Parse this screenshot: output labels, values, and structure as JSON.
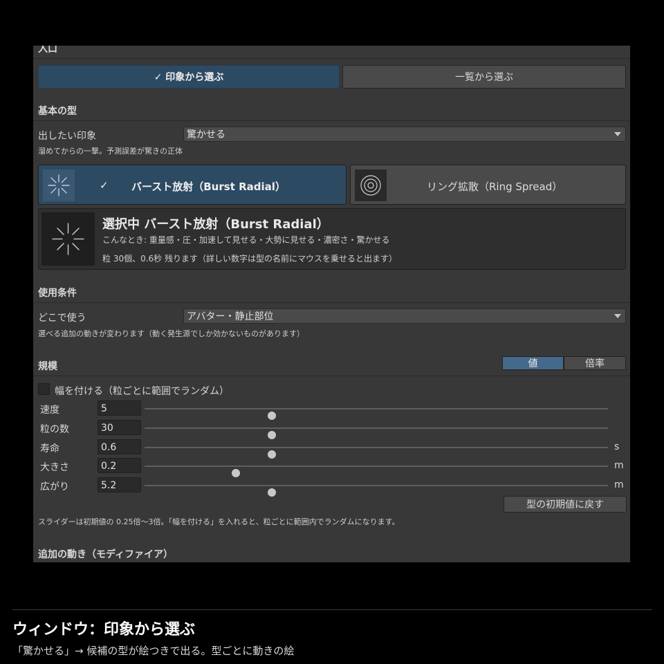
{
  "entry": {
    "header": "入口",
    "tab_selected": "✓ 印象から選ぶ",
    "tab_other": "一覧から選ぶ"
  },
  "basic_type": {
    "header": "基本の型",
    "impression_label": "出したい印象",
    "impression_value": "驚かせる",
    "impression_hint": "溜めてからの一撃。予測誤差が驚きの正体",
    "cards": [
      {
        "check": "✓",
        "label": "バースト放射（Burst Radial）",
        "icon": "burst-radial-icon",
        "selected": true
      },
      {
        "label": "リング拡散（Ring Spread）",
        "icon": "ring-spread-icon",
        "selected": false
      }
    ],
    "selected_info": {
      "title": "選択中 バースト放射（Burst Radial）",
      "usage": "こんなとき: 重量感・圧・加速して見せる・大勢に見せる・濃密さ・驚かせる",
      "detail": "粒 30個、0.6秒 残ります（詳しい数字は型の名前にマウスを乗せると出ます）",
      "icon": "burst-radial-icon"
    }
  },
  "usage_condition": {
    "header": "使用条件",
    "where_label": "どこで使う",
    "where_value": "アバター・静止部位",
    "where_hint": "選べる追加の動きが変わります（動く発生源でしか効かないものがあります）"
  },
  "scale": {
    "header": "規模",
    "mode_value": "値",
    "mode_ratio": "倍率",
    "mode_selected": "値",
    "range_checkbox": "幅を付ける（粒ごとに範囲でランダム）",
    "range_checked": false,
    "sliders": [
      {
        "label": "速度",
        "value": "5",
        "unit": "",
        "position": 0.275
      },
      {
        "label": "粒の数",
        "value": "30",
        "unit": "",
        "position": 0.275
      },
      {
        "label": "寿命",
        "value": "0.6",
        "unit": "s",
        "position": 0.275
      },
      {
        "label": "大きさ",
        "value": "0.2",
        "unit": "m",
        "position": 0.197
      },
      {
        "label": "広がり",
        "value": "5.2",
        "unit": "m",
        "position": 0.275
      }
    ],
    "reset_button": "型の初期値に戻す",
    "note": "スライダーは初期値の 0.25倍～3倍。「幅を付ける」を入れると、粒ごとに範囲内でランダムになります。"
  },
  "modifiers": {
    "header": "追加の動き（モディファイア）"
  },
  "caption": {
    "title": "ウィンドウ：印象から選ぶ",
    "subtitle": "「驚かせる」→ 候補の型が絵つきで出る。型ごとに動きの絵"
  },
  "colors": {
    "panel": "#383838",
    "accent": "#2d4a63",
    "button": "#4a4a4a"
  }
}
